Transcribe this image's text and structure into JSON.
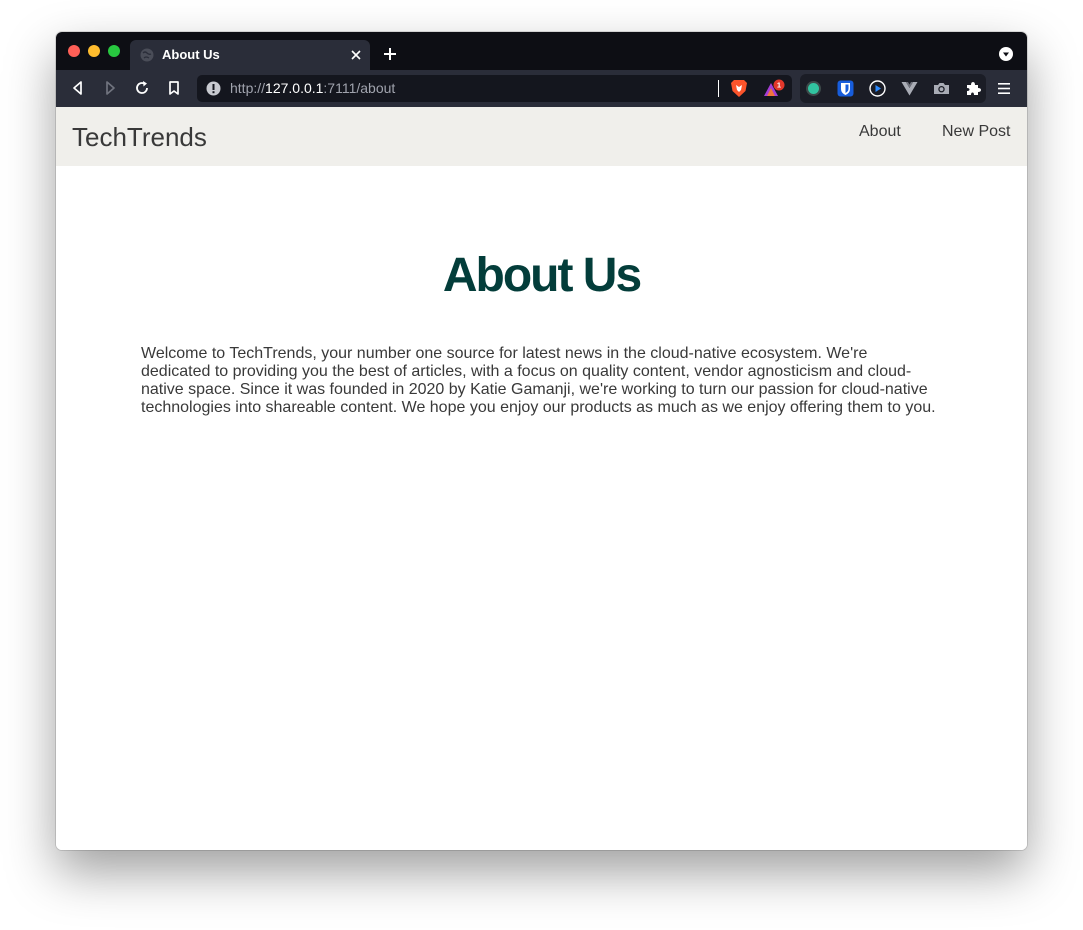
{
  "browser": {
    "tab_title": "About Us",
    "url_scheme": "http://",
    "url_host": "127.0.0.1",
    "url_path": ":7111/about",
    "rewards_badge": "1"
  },
  "icons": [
    "back-icon",
    "forward-icon",
    "reload-icon",
    "bookmark-icon",
    "site-info-icon",
    "brave-shields-icon",
    "brave-rewards-icon",
    "extension-green-dot-icon",
    "bitwarden-icon",
    "extension-play-icon",
    "vue-devtools-icon",
    "camera-icon",
    "extensions-puzzle-icon",
    "menu-icon"
  ],
  "colors": {
    "heading": "#033d3a",
    "navbar_bg": "#f0efeb",
    "text": "#393939"
  },
  "navbar": {
    "brand": "TechTrends",
    "links": [
      "About",
      "New Post"
    ]
  },
  "content": {
    "heading": "About Us",
    "paragraph": "Welcome to TechTrends, your number one source for latest news in the cloud-native ecosystem. We're dedicated to providing you the best of articles, with a focus on quality content, vendor agnosticism and cloud-native space. Since it was founded in 2020 by Katie Gamanji, we're working to turn our passion for cloud-native technologies into shareable content. We hope you enjoy our products as much as we enjoy offering them to you."
  }
}
